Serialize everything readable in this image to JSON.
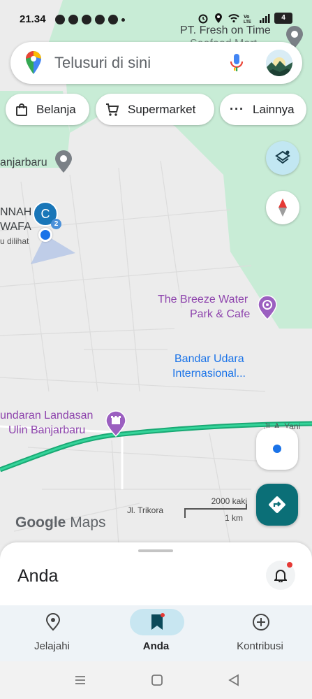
{
  "status_bar": {
    "time": "21.34",
    "battery": "4"
  },
  "search": {
    "placeholder": "Telusuri di sini"
  },
  "chips": [
    {
      "label": "Belanja",
      "icon": "shopping-bag-icon"
    },
    {
      "label": "Supermarket",
      "icon": "cart-icon"
    },
    {
      "label": "Lainnya",
      "icon": "more-horizontal-icon"
    }
  ],
  "map": {
    "labels": {
      "top_right": "PT. Fresh on Time",
      "top_right_partial": "Seafood Mart",
      "banjarbaru": "anjarbaru",
      "nnah": "NNAH",
      "wafa": "WAFA",
      "dilihat": "u dilihat",
      "breeze_1": "The Breeze Water",
      "breeze_2": "Park & Cafe",
      "airport_1": "Bandar Udara",
      "airport_2": "Internasional...",
      "landasan_1": "undaran Landasan",
      "landasan_2": "Ulin Banjarbaru",
      "road_yani": "Jl. A. Yani",
      "road_trikora": "Jl. Trikora"
    },
    "marker_letter": "C",
    "marker_badge": "2",
    "scale_top": "2000 kaki",
    "scale_bottom": "1 km",
    "logo_google": "Google",
    "logo_maps": "Maps",
    "colors": {
      "park": "#c8ecd6",
      "route": "#1fb980",
      "poi_purple": "#9b5fc0",
      "airport_blue": "#1a73e8"
    }
  },
  "sheet": {
    "title": "Anda"
  },
  "nav": {
    "items": [
      {
        "label": "Jelajahi",
        "icon": "location-pin-icon",
        "active": false
      },
      {
        "label": "Anda",
        "icon": "bookmark-icon",
        "active": true
      },
      {
        "label": "Kontribusi",
        "icon": "add-circle-icon",
        "active": false
      }
    ]
  }
}
